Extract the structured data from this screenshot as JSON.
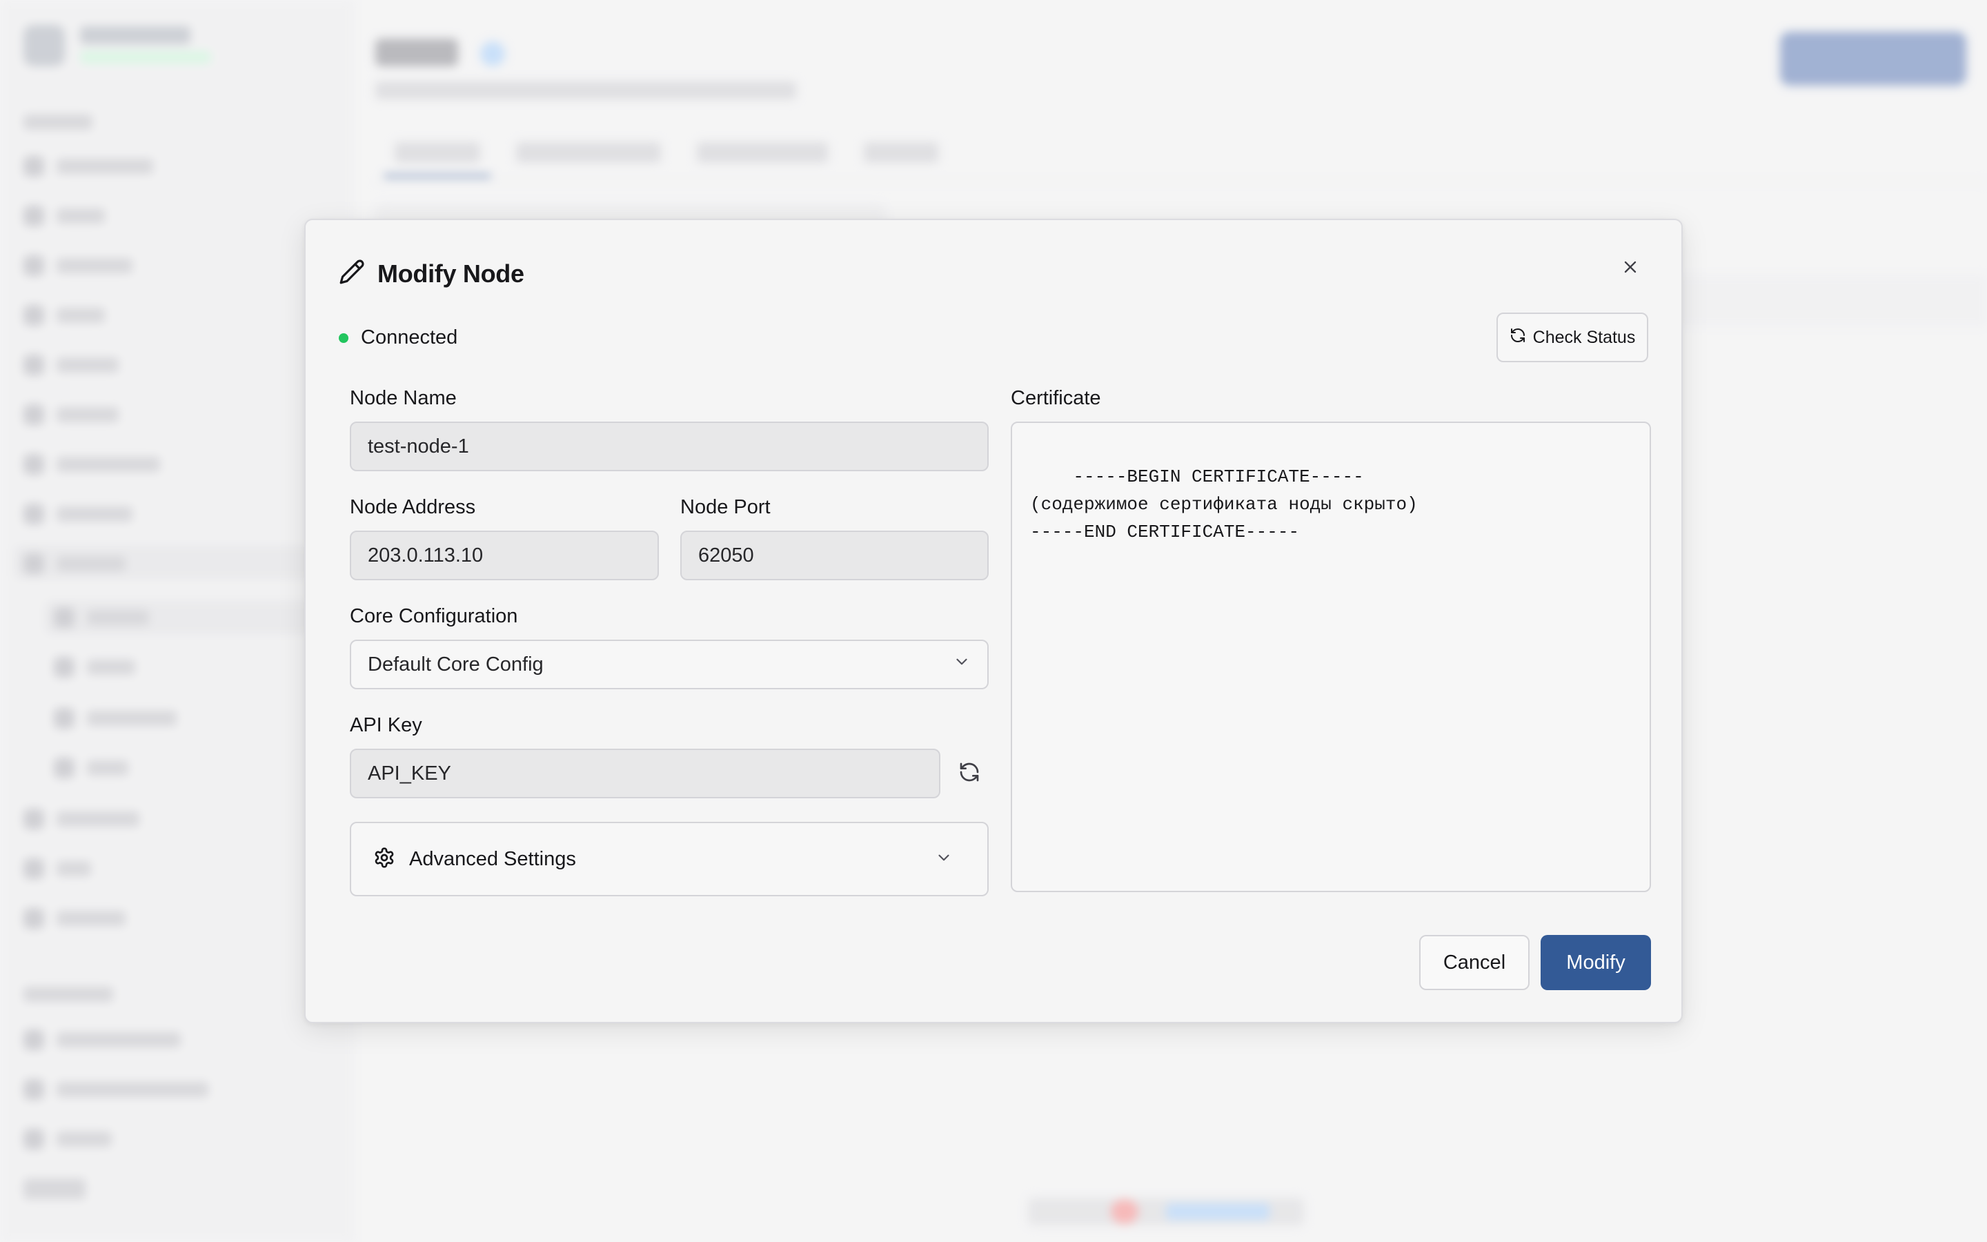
{
  "modal": {
    "title": "Modify Node",
    "status": {
      "label": "Connected",
      "color": "#22c55e"
    },
    "check_status_label": "Check Status",
    "fields": {
      "node_name": {
        "label": "Node Name",
        "value": "test-node-1"
      },
      "node_address": {
        "label": "Node Address",
        "value": "203.0.113.10"
      },
      "node_port": {
        "label": "Node Port",
        "value": "62050"
      },
      "core_configuration": {
        "label": "Core Configuration",
        "selected": "Default Core Config"
      },
      "api_key": {
        "label": "API Key",
        "value": "API_KEY"
      },
      "certificate": {
        "label": "Certificate",
        "value": "-----BEGIN CERTIFICATE-----\n(содержимое сертификата ноды скрыто)\n-----END CERTIFICATE-----"
      }
    },
    "advanced_settings_label": "Advanced Settings",
    "cancel_label": "Cancel",
    "modify_label": "Modify",
    "primary_color": "#335a96"
  },
  "icons": {
    "title": "pencil-icon",
    "close": "close-icon",
    "check_status": "refresh-icon",
    "select": "chevron-down-icon",
    "api_key_regenerate": "refresh-icon",
    "advanced": "gear-icon"
  }
}
